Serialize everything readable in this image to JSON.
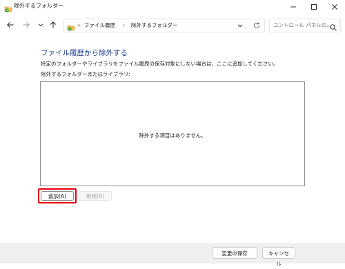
{
  "window": {
    "title": "除外するフォルダー",
    "icon": "folder-history-icon"
  },
  "nav": {
    "back_icon": "arrow-left-icon",
    "forward_icon": "arrow-right-icon",
    "recent_icon": "chevron-down-icon",
    "up_icon": "arrow-up-icon"
  },
  "address": {
    "overflow": "«",
    "breadcrumbs": [
      "ファイル履歴",
      "除外するフォルダー"
    ],
    "separator": "›"
  },
  "search": {
    "placeholder": "コントロール パネルの..."
  },
  "main": {
    "heading": "ファイル履歴から除外する",
    "description": "特定のフォルダーやライブラリをファイル履歴の保存対象にしない場合は、ここに追加してください。",
    "list_label": "除外するフォルダーまたはライブラリ:",
    "empty_message": "除外する項目はありません。",
    "add_label": "追加(A)",
    "remove_label": "削除(R)"
  },
  "footer": {
    "save_label": "変更の保存",
    "cancel_label": "キャンセル"
  },
  "colors": {
    "heading": "#1e3f8a",
    "highlight": "#e8000c",
    "footer_bg": "#f0f0f0"
  }
}
